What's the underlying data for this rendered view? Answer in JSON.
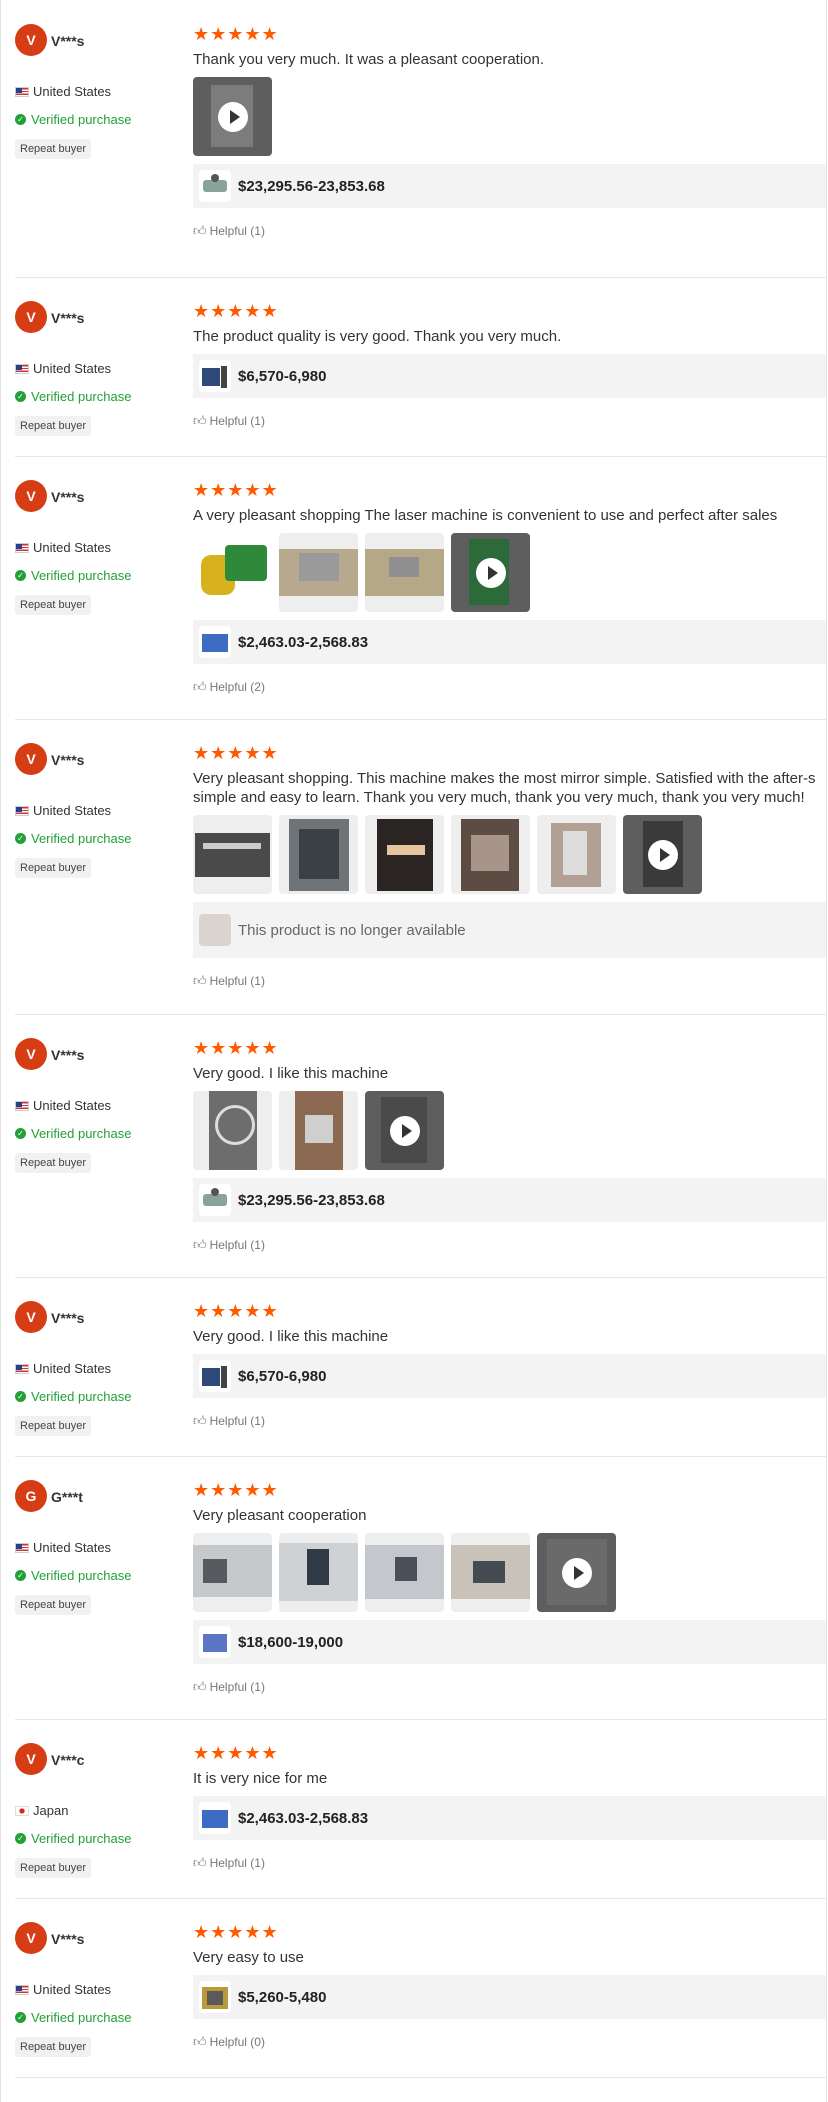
{
  "labels": {
    "verified": "Verified purchase",
    "repeat": "Repeat buyer",
    "helpful_prefix": "Helpful",
    "unavailable": "This product is no longer available"
  },
  "colors": {
    "star": "#ff5a00",
    "avatar": "#d63d14",
    "verified": "#22a036"
  },
  "reviews": [
    {
      "initial": "V",
      "user": "V***s",
      "country": "United States",
      "flag": "us-flag-icon",
      "stars": "★★★★★",
      "text": "Thank you very much. It was a pleasant cooperation.",
      "price": "$23,295.56-23,853.68",
      "helpful": "Helpful (1)"
    },
    {
      "initial": "V",
      "user": "V***s",
      "country": "United States",
      "flag": "us-flag-icon",
      "stars": "★★★★★",
      "text": "The product quality is very good. Thank you very much.",
      "price": "$6,570-6,980",
      "helpful": "Helpful (1)"
    },
    {
      "initial": "V",
      "user": "V***s",
      "country": "United States",
      "flag": "us-flag-icon",
      "stars": "★★★★★",
      "text": "A very pleasant shopping The laser machine is convenient to use and perfect after sales",
      "price": "$2,463.03-2,568.83",
      "helpful": "Helpful (2)"
    },
    {
      "initial": "V",
      "user": "V***s",
      "country": "United States",
      "flag": "us-flag-icon",
      "stars": "★★★★★",
      "text": "Very pleasant shopping. This machine makes the most mirror simple. Satisfied with the after-s",
      "text2": "simple and easy to learn. Thank you very much, thank you very much, thank you very much!",
      "price": "This product is no longer available",
      "helpful": "Helpful (1)"
    },
    {
      "initial": "V",
      "user": "V***s",
      "country": "United States",
      "flag": "us-flag-icon",
      "stars": "★★★★★",
      "text": "Very good. I like this machine",
      "price": "$23,295.56-23,853.68",
      "helpful": "Helpful (1)"
    },
    {
      "initial": "V",
      "user": "V***s",
      "country": "United States",
      "flag": "us-flag-icon",
      "stars": "★★★★★",
      "text": "Very good. I like this machine",
      "price": "$6,570-6,980",
      "helpful": "Helpful (1)"
    },
    {
      "initial": "G",
      "user": "G***t",
      "country": "United States",
      "flag": "us-flag-icon",
      "stars": "★★★★★",
      "text": "Very pleasant cooperation",
      "price": "$18,600-19,000",
      "helpful": "Helpful (1)"
    },
    {
      "initial": "V",
      "user": "V***c",
      "country": "Japan",
      "flag": "japan-flag-icon",
      "stars": "★★★★★",
      "text": "It is very nice for me",
      "price": "$2,463.03-2,568.83",
      "helpful": "Helpful (1)"
    },
    {
      "initial": "V",
      "user": "V***s",
      "country": "United States",
      "flag": "us-flag-icon",
      "stars": "★★★★★",
      "text": "Very easy to use",
      "price": "$5,260-5,480",
      "helpful": "Helpful (0)"
    }
  ]
}
